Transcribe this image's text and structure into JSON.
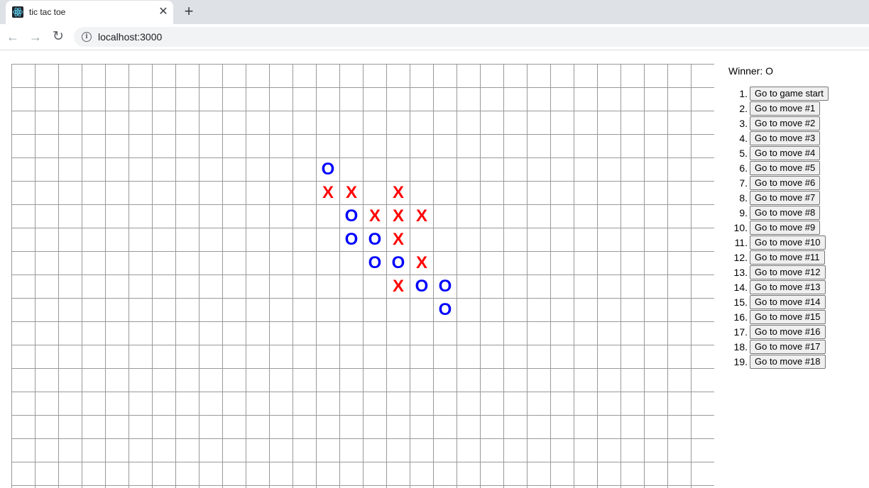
{
  "browser": {
    "tab_title": "tic tac toe",
    "tab_close_glyph": "✕",
    "new_tab_glyph": "+",
    "url": "localhost:3000",
    "icons": {
      "favicon": "react-logo-icon",
      "back": "arrow-left-icon",
      "forward": "arrow-right-icon",
      "reload": "reload-icon",
      "site_info": "info-icon"
    }
  },
  "board": {
    "columns": 30,
    "visible_rows": 19,
    "colors": {
      "X": "#ff0000",
      "O": "#0000ff",
      "grid": "#999999"
    },
    "marks": [
      {
        "row": 4,
        "col": 13,
        "value": "O"
      },
      {
        "row": 5,
        "col": 13,
        "value": "X"
      },
      {
        "row": 5,
        "col": 14,
        "value": "X"
      },
      {
        "row": 5,
        "col": 16,
        "value": "X"
      },
      {
        "row": 6,
        "col": 14,
        "value": "O"
      },
      {
        "row": 6,
        "col": 15,
        "value": "X"
      },
      {
        "row": 6,
        "col": 16,
        "value": "X"
      },
      {
        "row": 6,
        "col": 17,
        "value": "X"
      },
      {
        "row": 7,
        "col": 14,
        "value": "O"
      },
      {
        "row": 7,
        "col": 15,
        "value": "O"
      },
      {
        "row": 7,
        "col": 16,
        "value": "X"
      },
      {
        "row": 8,
        "col": 15,
        "value": "O"
      },
      {
        "row": 8,
        "col": 16,
        "value": "O"
      },
      {
        "row": 8,
        "col": 17,
        "value": "X"
      },
      {
        "row": 9,
        "col": 16,
        "value": "X"
      },
      {
        "row": 9,
        "col": 17,
        "value": "O"
      },
      {
        "row": 9,
        "col": 18,
        "value": "O"
      },
      {
        "row": 10,
        "col": 18,
        "value": "O"
      }
    ]
  },
  "game_info": {
    "status": "Winner: O",
    "moves": [
      {
        "num": "1.",
        "label": "Go to game start"
      },
      {
        "num": "2.",
        "label": "Go to move #1"
      },
      {
        "num": "3.",
        "label": "Go to move #2"
      },
      {
        "num": "4.",
        "label": "Go to move #3"
      },
      {
        "num": "5.",
        "label": "Go to move #4"
      },
      {
        "num": "6.",
        "label": "Go to move #5"
      },
      {
        "num": "7.",
        "label": "Go to move #6"
      },
      {
        "num": "8.",
        "label": "Go to move #7"
      },
      {
        "num": "9.",
        "label": "Go to move #8"
      },
      {
        "num": "10.",
        "label": "Go to move #9"
      },
      {
        "num": "11.",
        "label": "Go to move #10"
      },
      {
        "num": "12.",
        "label": "Go to move #11"
      },
      {
        "num": "13.",
        "label": "Go to move #12"
      },
      {
        "num": "14.",
        "label": "Go to move #13"
      },
      {
        "num": "15.",
        "label": "Go to move #14"
      },
      {
        "num": "16.",
        "label": "Go to move #15"
      },
      {
        "num": "17.",
        "label": "Go to move #16"
      },
      {
        "num": "18.",
        "label": "Go to move #17"
      },
      {
        "num": "19.",
        "label": "Go to move #18"
      }
    ]
  }
}
